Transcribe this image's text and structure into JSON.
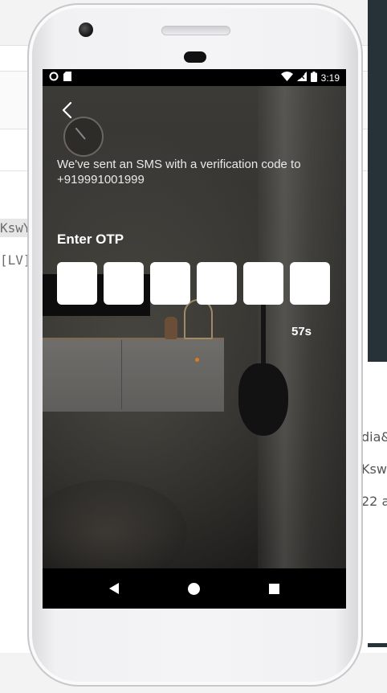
{
  "status_bar": {
    "time": "3:19",
    "icons": [
      "circle-notification-icon",
      "sd-card-icon",
      "wifi-icon",
      "signal-icon",
      "battery-icon"
    ]
  },
  "background_page": {
    "left_fragments": [
      "KswY",
      "[LV]"
    ],
    "right_fragments": [
      "dia&",
      "Ksw",
      "22 a"
    ]
  },
  "otp_screen": {
    "message": "We've sent an SMS with a verification code to +919991001999",
    "label": "Enter OTP",
    "digits": [
      "",
      "",
      "",
      "",
      "",
      ""
    ],
    "timer": "57s"
  },
  "nav_bar": {
    "buttons": [
      "back-icon",
      "home-icon",
      "recents-icon"
    ]
  },
  "colors": {
    "accent_orange": "#e07a1f",
    "otp_box": "#ffffff"
  }
}
